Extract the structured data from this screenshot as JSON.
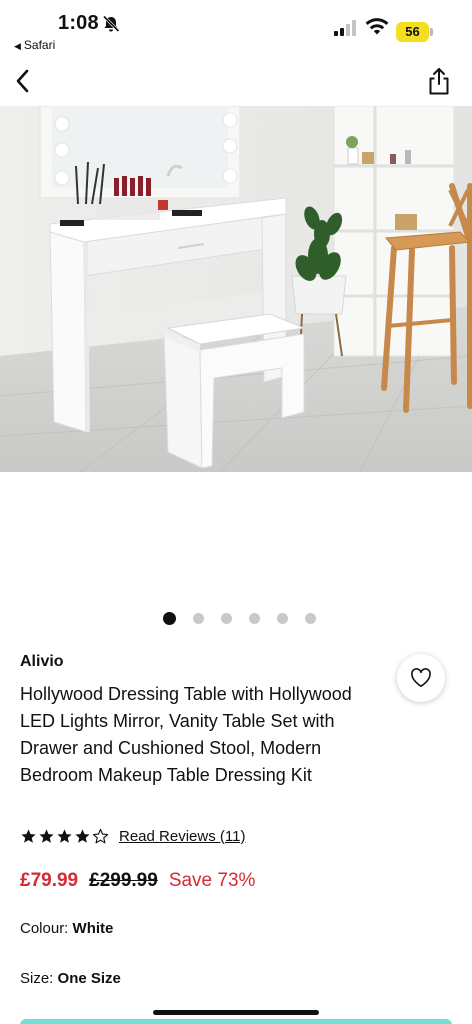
{
  "status_bar": {
    "time": "1:08",
    "back_app": "Safari",
    "battery": "56"
  },
  "carousel": {
    "image_alt": "Hollywood Dressing Table with mirror, lights, drawer and cushioned stool",
    "dot_count": 6,
    "active_index": 0
  },
  "product": {
    "brand": "Alivio",
    "title": "Hollywood Dressing Table with Hollywood LED Lights Mirror, Vanity Table Set with Drawer and Cushioned Stool, Modern Bedroom Makeup Table Dressing Kit",
    "rating": 4,
    "rating_max": 5,
    "reviews_link": "Read Reviews (11)",
    "price_now": "£79.99",
    "price_was": "£299.99",
    "price_save": "Save 73%",
    "colour_label": "Colour:",
    "colour_value": "White",
    "size_label": "Size:",
    "size_value": "One Size"
  },
  "colors": {
    "price_red": "#d42b35",
    "cta_teal": "#6fe1d6",
    "battery_yellow": "#f5de20"
  },
  "icons": {
    "back": "chevron-left-icon",
    "share": "share-icon",
    "wishlist": "heart-icon",
    "star": "star-icon"
  }
}
